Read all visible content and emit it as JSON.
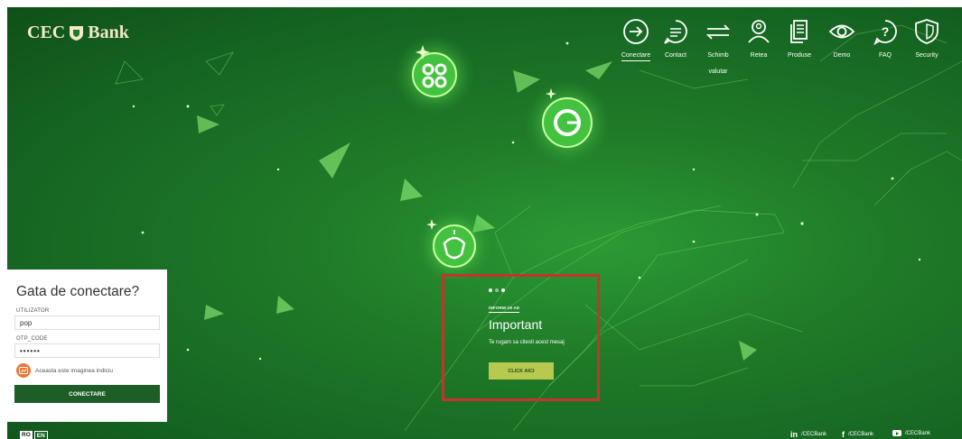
{
  "brand": {
    "name_left": "CEC",
    "name_right": "Bank"
  },
  "nav": [
    {
      "label": "Conectare",
      "icon": "login-arrow-icon",
      "active": true
    },
    {
      "label": "Contact",
      "icon": "chat-bubble-icon"
    },
    {
      "label": "Schimb\nvalutar",
      "icon": "exchange-arrows-icon"
    },
    {
      "label": "Retea",
      "icon": "location-person-icon"
    },
    {
      "label": "Produse",
      "icon": "documents-icon"
    },
    {
      "label": "Demo",
      "icon": "eye-icon"
    },
    {
      "label": "FAQ",
      "icon": "question-icon"
    },
    {
      "label": "Security",
      "icon": "shield-icon"
    }
  ],
  "login": {
    "title": "Gata de conectare?",
    "user_label": "UTILIZATOR",
    "user_value": "pop",
    "otp_label": "OTP_CODE",
    "otp_value": "••••••",
    "hint_text": "Aceasta este imaginea indiciu",
    "connect_button": "CONECTARE"
  },
  "lang": {
    "ro": "RO",
    "en": "EN",
    "selected": "EN"
  },
  "notice": {
    "tag": "INFORM-19 AD",
    "title": "Important",
    "message": "Te rugam sa citesti acest mesaj",
    "button": "CLICK AICI",
    "slides": 3,
    "active_slide": 1
  },
  "social": [
    {
      "network": "linkedin",
      "icon": "in",
      "handle": "/CECBank"
    },
    {
      "network": "facebook",
      "icon": "f",
      "handle": "/CECBank"
    },
    {
      "network": "youtube",
      "icon": "",
      "handle": "/CECBank"
    }
  ],
  "colors": {
    "background": "#1f7a28",
    "brand_text": "#f1e9c7",
    "button_dark": "#1c5e26",
    "notice_button": "#b7c94e",
    "highlight_border": "#c7332a"
  }
}
